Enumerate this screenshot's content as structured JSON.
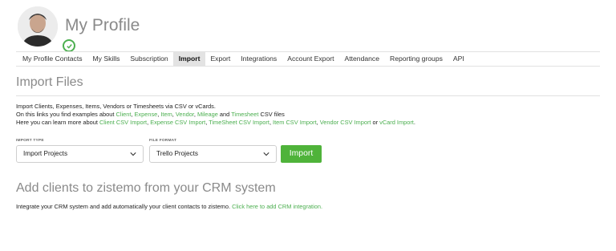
{
  "profile": {
    "title": "My Profile"
  },
  "tabs": [
    {
      "label": "My Profile Contacts",
      "active": false
    },
    {
      "label": "My Skills",
      "active": false
    },
    {
      "label": "Subscription",
      "active": false
    },
    {
      "label": "Import",
      "active": true
    },
    {
      "label": "Export",
      "active": false
    },
    {
      "label": "Integrations",
      "active": false
    },
    {
      "label": "Account Export",
      "active": false
    },
    {
      "label": "Attendance",
      "active": false
    },
    {
      "label": "Reporting groups",
      "active": false
    },
    {
      "label": "API",
      "active": false
    }
  ],
  "import_files": {
    "title": "Import Files",
    "line1": "Import Clients, Expenses, Items, Vendors or Timesheets via CSV or vCards.",
    "line2": {
      "prefix": "On this links you find examples about ",
      "client": "Client",
      "sep1": ", ",
      "expense": "Expense",
      "sep2": ", ",
      "item": "Item",
      "sep3": ", ",
      "vendor": "Vendor",
      "sep4": ", ",
      "mileage": "Mileage",
      "and": " and ",
      "timesheet": "Timesheet",
      "suffix": " CSV files"
    },
    "line3": {
      "prefix": "Here you can learn more about ",
      "client_import": "Client CSV Import",
      "sep1": ", ",
      "expense_import": "Expense CSV Import",
      "sep2": ", ",
      "timesheet_import": "TimeSheet CSV Import",
      "sep3": ", ",
      "item_import": "Item CSV Import",
      "sep4": ", ",
      "vendor_import": "Vendor CSV Import",
      "or": " or ",
      "vcard_import": "vCard Import",
      "end": "."
    },
    "import_type_label": "IMPORT TYPE",
    "import_type_value": "Import Projects",
    "file_format_label": "FILE FORMAT",
    "file_format_value": "Trello Projects",
    "import_button": "Import"
  },
  "crm": {
    "title": "Add clients to zistemo from your CRM system",
    "text": "Integrate your CRM system and add automatically your client contacts to zistemo. ",
    "link": "Click here to add CRM integration."
  },
  "colors": {
    "accent": "#4caf50",
    "button": "#4fb33a",
    "heading": "#8a8a8a"
  },
  "icons": [
    "user-avatar",
    "verified-check-icon",
    "chevron-down-icon"
  ]
}
